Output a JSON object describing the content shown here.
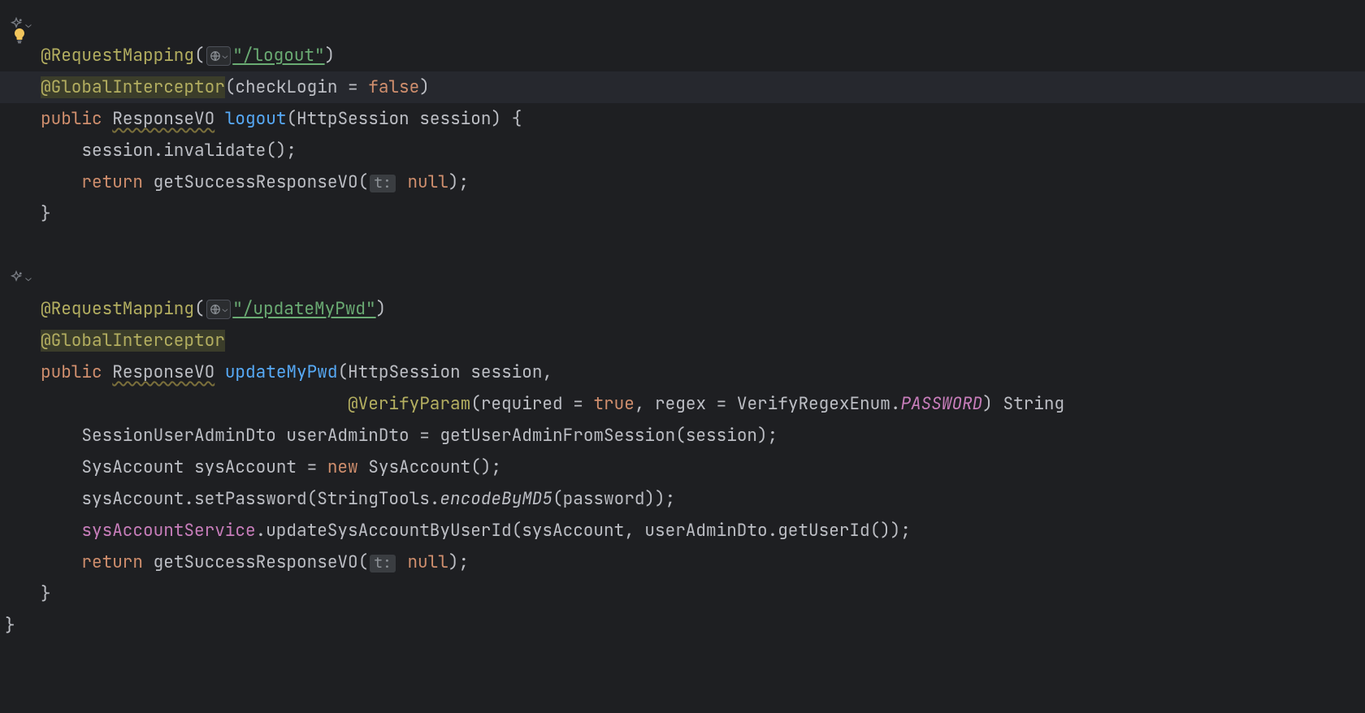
{
  "gutter": {
    "bulb_color": "#f2c55c",
    "ai_icon_label": "ai-assist",
    "chevron": "⌄"
  },
  "method1": {
    "anno1_name": "@RequestMapping",
    "anno1_url": "\"/logout\"",
    "anno2_name": "@GlobalInterceptor",
    "anno2_param_name": "checkLogin",
    "anno2_param_eq": " = ",
    "anno2_param_val": "false",
    "kw_public": "public",
    "ret_type": "ResponseVO",
    "method_name": "logout",
    "param_type": "HttpSession",
    "param_name": "session",
    "body_l1_obj": "session",
    "body_l1_call": ".invalidate();",
    "kw_return": "return",
    "ret_call": "getSuccessResponseVO(",
    "hint_t": "t:",
    "ret_null": "null",
    "ret_close": ");"
  },
  "method2": {
    "anno1_name": "@RequestMapping",
    "anno1_url": "\"/updateMyPwd\"",
    "anno2_name": "@GlobalInterceptor",
    "kw_public": "public",
    "ret_type": "ResponseVO",
    "method_name": "updateMyPwd",
    "p1_type": "HttpSession",
    "p1_name": "session",
    "p2_anno": "@VerifyParam",
    "p2_a1_name": "required",
    "p2_a1_eq": " = ",
    "p2_a1_val": "true",
    "p2_a2_name": "regex",
    "p2_a2_eq": " = ",
    "p2_a2_enum": "VerifyRegexEnum",
    "p2_a2_dot": ".",
    "p2_a2_const": "PASSWORD",
    "p2_type": "String",
    "b1_type": "SessionUserAdminDto",
    "b1_var": "userAdminDto",
    "b1_eq": " = ",
    "b1_call": "getUserAdminFromSession(session);",
    "b2_type": "SysAccount",
    "b2_var": "sysAccount",
    "b2_eq": " = ",
    "b2_kw_new": "new",
    "b2_ctor": " SysAccount();",
    "b3_obj": "sysAccount",
    "b3_m1": ".setPassword(StringTools.",
    "b3_static": "encodeByMD5",
    "b3_m2": "(password));",
    "b4_field": "sysAccountService",
    "b4_call": ".updateSysAccountByUserId(sysAccount, userAdminDto.getUserId());",
    "kw_return": "return",
    "ret_call": "getSuccessResponseVO(",
    "hint_t": "t:",
    "ret_null": "null",
    "ret_close": ");"
  },
  "punc": {
    "open_paren": "(",
    "close_paren": ")",
    "open_brace": "{",
    "close_brace": "}",
    "comma_space": ", ",
    "space": " "
  }
}
